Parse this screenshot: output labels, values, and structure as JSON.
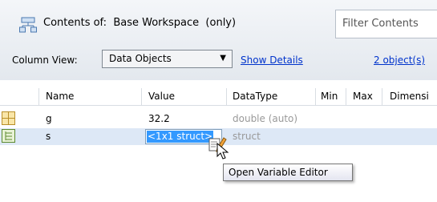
{
  "toolbar": {
    "contents_label": "Contents of:  Base Workspace  (only)",
    "filter_placeholder": "Filter Contents",
    "column_view_label": "Column View:",
    "column_view_value": "Data Objects",
    "show_details": "Show Details",
    "object_count": "2 object(s)"
  },
  "table": {
    "headers": [
      "Name",
      "Value",
      "DataType",
      "Min",
      "Max",
      "Dimensi"
    ],
    "rows": [
      {
        "name": "g",
        "value": "32.2",
        "datatype": "double (auto)"
      },
      {
        "name": "s",
        "value": "<1x1 struct>",
        "datatype": "struct"
      }
    ]
  },
  "tooltip": "Open Variable Editor",
  "colors": {
    "selection": "#dde8f6",
    "link": "#0033cc",
    "text_selection": "#3399ff",
    "muted_text": "#999999"
  }
}
